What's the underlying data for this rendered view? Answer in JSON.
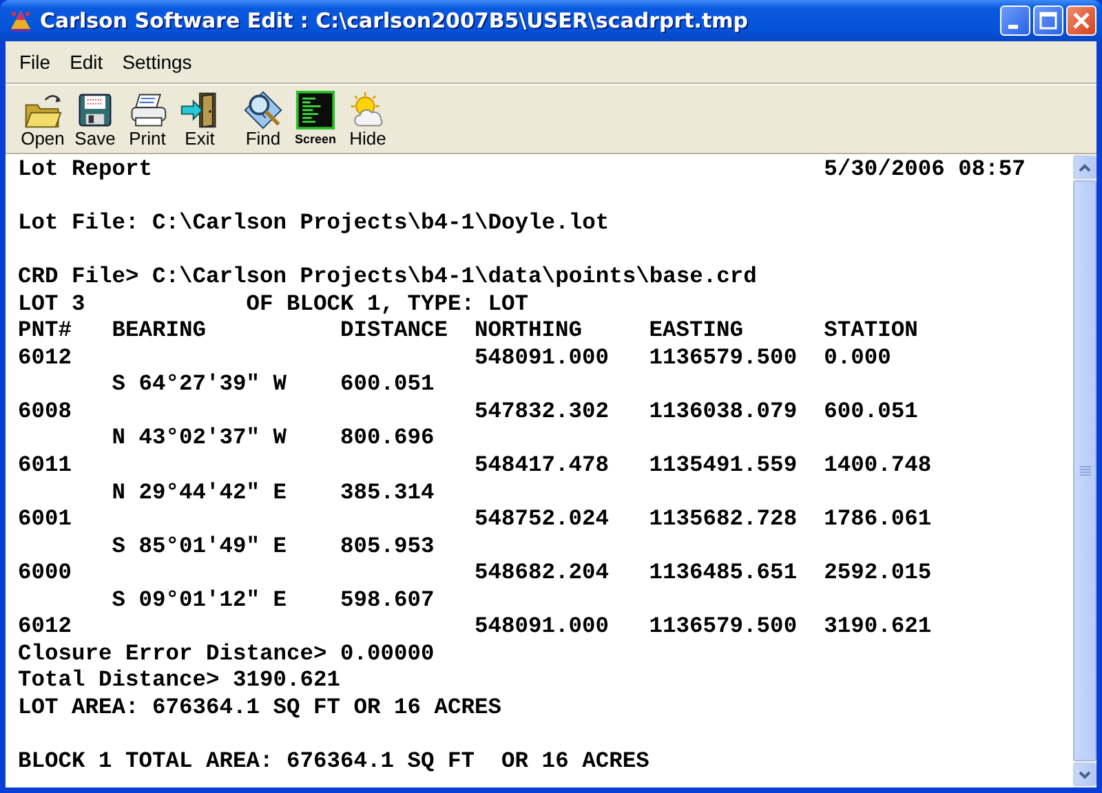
{
  "window": {
    "title": "Carlson Software Edit : C:\\carlson2007B5\\USER\\scadrprt.tmp"
  },
  "menu": [
    {
      "label": "File"
    },
    {
      "label": "Edit"
    },
    {
      "label": "Settings"
    }
  ],
  "toolbar": [
    {
      "kind": "open",
      "label": "Open"
    },
    {
      "kind": "save",
      "label": "Save"
    },
    {
      "kind": "print",
      "label": "Print"
    },
    {
      "kind": "exit",
      "label": "Exit"
    },
    {
      "kind": "find",
      "label": "Find"
    },
    {
      "kind": "screen",
      "label": "Screen"
    },
    {
      "kind": "hide",
      "label": "Hide"
    }
  ],
  "report": {
    "title": "Lot Report",
    "date": "5/30/2006 08:57",
    "lot_file": "Lot File: C:\\Carlson Projects\\b4-1\\Doyle.lot",
    "crd_file": "CRD File> C:\\Carlson Projects\\b4-1\\data\\points\\base.crd",
    "lot": "LOT 3",
    "lot_info": "OF BLOCK 1, TYPE: LOT",
    "columns": [
      "PNT#",
      "BEARING",
      "DISTANCE",
      "NORTHING",
      "EASTING",
      "STATION"
    ],
    "rows": [
      {
        "kind": "point",
        "pnt": "6012",
        "northing": "548091.000",
        "easting": "1136579.500",
        "station": "0.000"
      },
      {
        "kind": "course",
        "bearing": "S 64°27'39\" W",
        "distance": "600.051"
      },
      {
        "kind": "point",
        "pnt": "6008",
        "northing": "547832.302",
        "easting": "1136038.079",
        "station": "600.051"
      },
      {
        "kind": "course",
        "bearing": "N 43°02'37\" W",
        "distance": "800.696"
      },
      {
        "kind": "point",
        "pnt": "6011",
        "northing": "548417.478",
        "easting": "1135491.559",
        "station": "1400.748"
      },
      {
        "kind": "course",
        "bearing": "N 29°44'42\" E",
        "distance": "385.314"
      },
      {
        "kind": "point",
        "pnt": "6001",
        "northing": "548752.024",
        "easting": "1135682.728",
        "station": "1786.061"
      },
      {
        "kind": "course",
        "bearing": "S 85°01'49\" E",
        "distance": "805.953"
      },
      {
        "kind": "point",
        "pnt": "6000",
        "northing": "548682.204",
        "easting": "1136485.651",
        "station": "2592.015"
      },
      {
        "kind": "course",
        "bearing": "S 09°01'12\" E",
        "distance": "598.607"
      },
      {
        "kind": "point",
        "pnt": "6012",
        "northing": "548091.000",
        "easting": "1136579.500",
        "station": "3190.621"
      }
    ],
    "summary": [
      "Closure Error Distance> 0.00000",
      "Total Distance> 3190.621",
      "LOT AREA: 676364.1 SQ FT OR 16 ACRES"
    ],
    "block_total": "BLOCK 1 TOTAL AREA: 676364.1 SQ FT  OR 16 ACRES"
  }
}
